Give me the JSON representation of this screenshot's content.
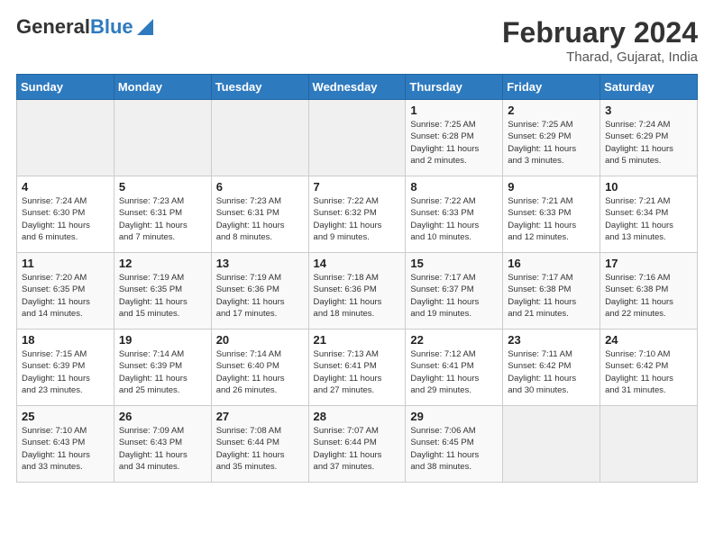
{
  "logo": {
    "line1": "General",
    "line2": "Blue"
  },
  "title": "February 2024",
  "subtitle": "Tharad, Gujarat, India",
  "days_of_week": [
    "Sunday",
    "Monday",
    "Tuesday",
    "Wednesday",
    "Thursday",
    "Friday",
    "Saturday"
  ],
  "weeks": [
    [
      {
        "day": "",
        "info": ""
      },
      {
        "day": "",
        "info": ""
      },
      {
        "day": "",
        "info": ""
      },
      {
        "day": "",
        "info": ""
      },
      {
        "day": "1",
        "info": "Sunrise: 7:25 AM\nSunset: 6:28 PM\nDaylight: 11 hours\nand 2 minutes."
      },
      {
        "day": "2",
        "info": "Sunrise: 7:25 AM\nSunset: 6:29 PM\nDaylight: 11 hours\nand 3 minutes."
      },
      {
        "day": "3",
        "info": "Sunrise: 7:24 AM\nSunset: 6:29 PM\nDaylight: 11 hours\nand 5 minutes."
      }
    ],
    [
      {
        "day": "4",
        "info": "Sunrise: 7:24 AM\nSunset: 6:30 PM\nDaylight: 11 hours\nand 6 minutes."
      },
      {
        "day": "5",
        "info": "Sunrise: 7:23 AM\nSunset: 6:31 PM\nDaylight: 11 hours\nand 7 minutes."
      },
      {
        "day": "6",
        "info": "Sunrise: 7:23 AM\nSunset: 6:31 PM\nDaylight: 11 hours\nand 8 minutes."
      },
      {
        "day": "7",
        "info": "Sunrise: 7:22 AM\nSunset: 6:32 PM\nDaylight: 11 hours\nand 9 minutes."
      },
      {
        "day": "8",
        "info": "Sunrise: 7:22 AM\nSunset: 6:33 PM\nDaylight: 11 hours\nand 10 minutes."
      },
      {
        "day": "9",
        "info": "Sunrise: 7:21 AM\nSunset: 6:33 PM\nDaylight: 11 hours\nand 12 minutes."
      },
      {
        "day": "10",
        "info": "Sunrise: 7:21 AM\nSunset: 6:34 PM\nDaylight: 11 hours\nand 13 minutes."
      }
    ],
    [
      {
        "day": "11",
        "info": "Sunrise: 7:20 AM\nSunset: 6:35 PM\nDaylight: 11 hours\nand 14 minutes."
      },
      {
        "day": "12",
        "info": "Sunrise: 7:19 AM\nSunset: 6:35 PM\nDaylight: 11 hours\nand 15 minutes."
      },
      {
        "day": "13",
        "info": "Sunrise: 7:19 AM\nSunset: 6:36 PM\nDaylight: 11 hours\nand 17 minutes."
      },
      {
        "day": "14",
        "info": "Sunrise: 7:18 AM\nSunset: 6:36 PM\nDaylight: 11 hours\nand 18 minutes."
      },
      {
        "day": "15",
        "info": "Sunrise: 7:17 AM\nSunset: 6:37 PM\nDaylight: 11 hours\nand 19 minutes."
      },
      {
        "day": "16",
        "info": "Sunrise: 7:17 AM\nSunset: 6:38 PM\nDaylight: 11 hours\nand 21 minutes."
      },
      {
        "day": "17",
        "info": "Sunrise: 7:16 AM\nSunset: 6:38 PM\nDaylight: 11 hours\nand 22 minutes."
      }
    ],
    [
      {
        "day": "18",
        "info": "Sunrise: 7:15 AM\nSunset: 6:39 PM\nDaylight: 11 hours\nand 23 minutes."
      },
      {
        "day": "19",
        "info": "Sunrise: 7:14 AM\nSunset: 6:39 PM\nDaylight: 11 hours\nand 25 minutes."
      },
      {
        "day": "20",
        "info": "Sunrise: 7:14 AM\nSunset: 6:40 PM\nDaylight: 11 hours\nand 26 minutes."
      },
      {
        "day": "21",
        "info": "Sunrise: 7:13 AM\nSunset: 6:41 PM\nDaylight: 11 hours\nand 27 minutes."
      },
      {
        "day": "22",
        "info": "Sunrise: 7:12 AM\nSunset: 6:41 PM\nDaylight: 11 hours\nand 29 minutes."
      },
      {
        "day": "23",
        "info": "Sunrise: 7:11 AM\nSunset: 6:42 PM\nDaylight: 11 hours\nand 30 minutes."
      },
      {
        "day": "24",
        "info": "Sunrise: 7:10 AM\nSunset: 6:42 PM\nDaylight: 11 hours\nand 31 minutes."
      }
    ],
    [
      {
        "day": "25",
        "info": "Sunrise: 7:10 AM\nSunset: 6:43 PM\nDaylight: 11 hours\nand 33 minutes."
      },
      {
        "day": "26",
        "info": "Sunrise: 7:09 AM\nSunset: 6:43 PM\nDaylight: 11 hours\nand 34 minutes."
      },
      {
        "day": "27",
        "info": "Sunrise: 7:08 AM\nSunset: 6:44 PM\nDaylight: 11 hours\nand 35 minutes."
      },
      {
        "day": "28",
        "info": "Sunrise: 7:07 AM\nSunset: 6:44 PM\nDaylight: 11 hours\nand 37 minutes."
      },
      {
        "day": "29",
        "info": "Sunrise: 7:06 AM\nSunset: 6:45 PM\nDaylight: 11 hours\nand 38 minutes."
      },
      {
        "day": "",
        "info": ""
      },
      {
        "day": "",
        "info": ""
      }
    ]
  ]
}
